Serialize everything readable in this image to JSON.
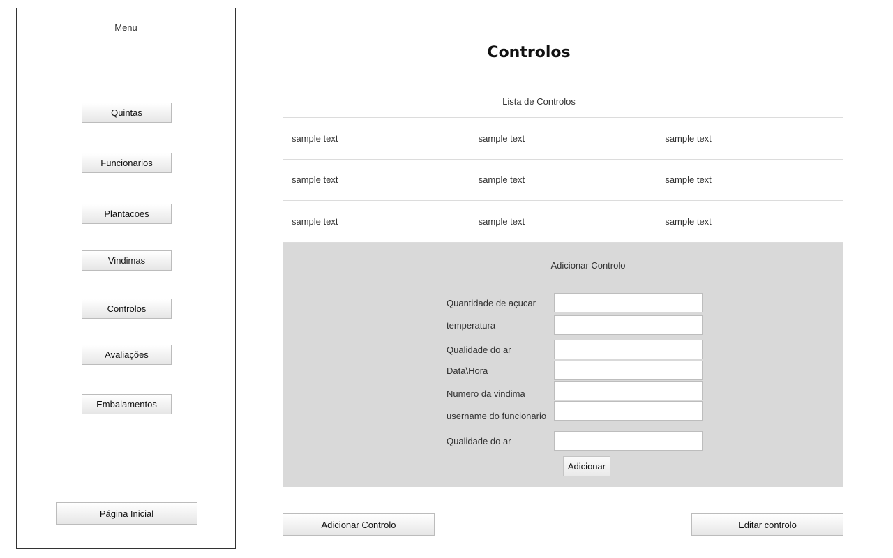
{
  "sidebar": {
    "title": "Menu",
    "items": [
      {
        "label": "Quintas"
      },
      {
        "label": "Funcionarios"
      },
      {
        "label": "Plantacoes"
      },
      {
        "label": "Vindimas"
      },
      {
        "label": "Controlos"
      },
      {
        "label": "Avaliações"
      },
      {
        "label": "Embalamentos"
      }
    ],
    "home_label": "Página Inicial"
  },
  "main": {
    "title": "Controlos",
    "list_caption": "Lista de Controlos",
    "table": {
      "rows": [
        [
          "sample text",
          "sample text",
          "sample text"
        ],
        [
          "sample text",
          "sample text",
          "sample text"
        ],
        [
          "sample text",
          "sample text",
          "sample text"
        ]
      ]
    },
    "form": {
      "title": "Adicionar Controlo",
      "fields": [
        {
          "label": "Quantidade de açucar",
          "value": ""
        },
        {
          "label": "temperatura",
          "value": ""
        },
        {
          "label": "Qualidade do ar",
          "value": ""
        },
        {
          "label": "Data\\Hora",
          "value": ""
        },
        {
          "label": "Numero da vindima",
          "value": ""
        },
        {
          "label": "username do funcionario",
          "value": ""
        },
        {
          "label": "Qualidade do ar",
          "value": ""
        }
      ],
      "submit_label": "Adicionar"
    },
    "actions": {
      "add_label": "Adicionar Controlo",
      "edit_label": "Editar controlo"
    }
  }
}
